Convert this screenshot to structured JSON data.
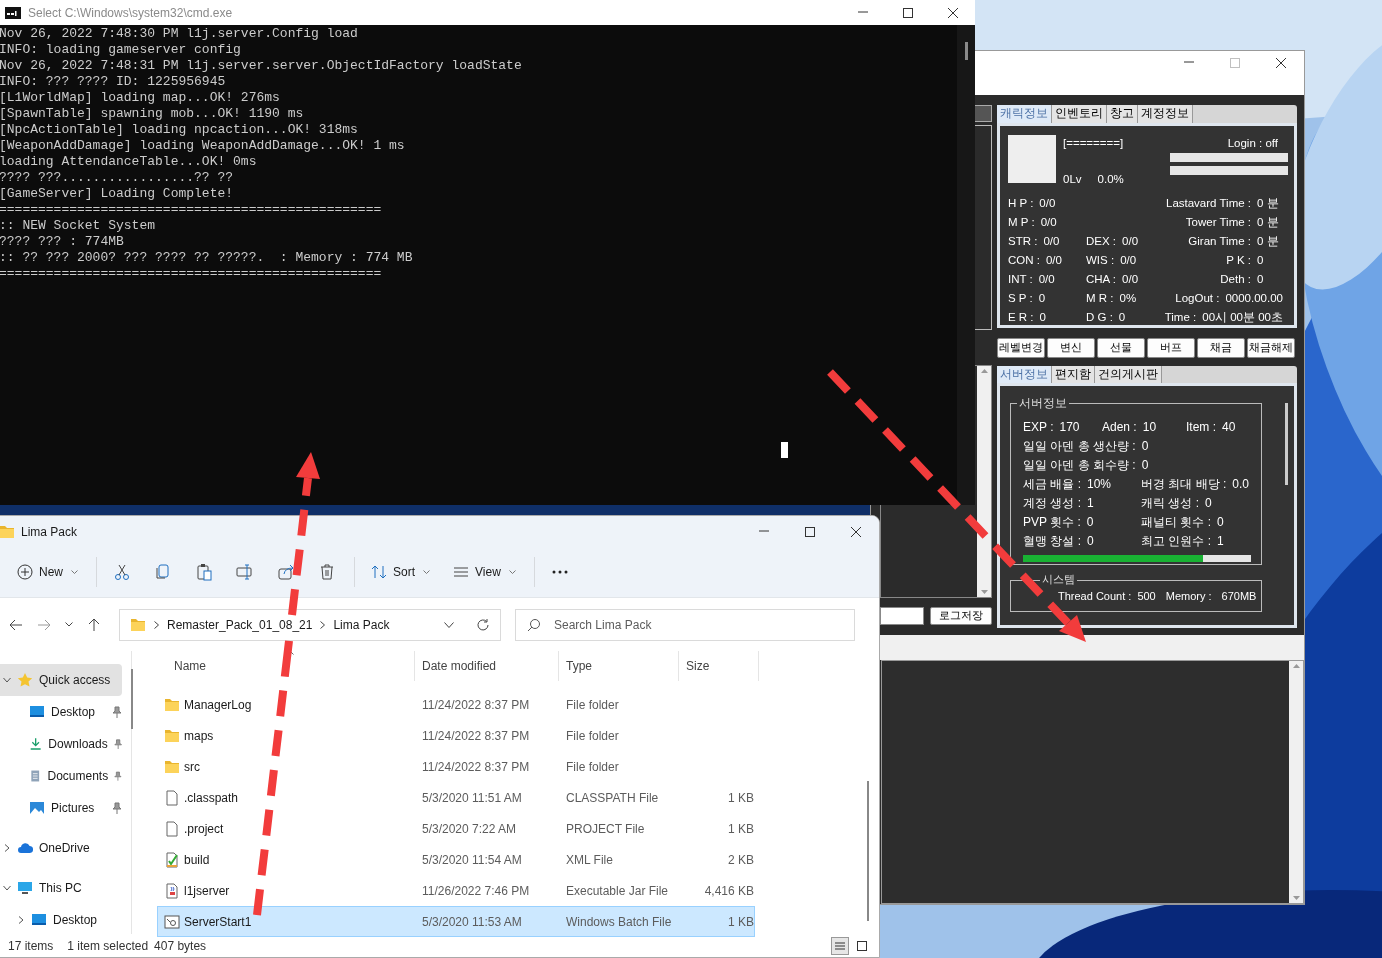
{
  "cmd_window": {
    "title": "Select C:\\Windows\\system32\\cmd.exe",
    "lines": [
      "Nov 26, 2022 7:48:30 PM l1j.server.Config load",
      "INFO: loading gameserver config",
      "Nov 26, 2022 7:48:31 PM l1j.server.server.ObjectIdFactory loadState",
      "INFO: ??? ???? ID: 1225956945",
      "[L1WorldMap] loading map...OK! 276ms",
      "[SpawnTable] spawning mob...OK! 1190 ms",
      "[NpcActionTable] loading npcaction...OK! 318ms",
      "[WeaponAddDamage] loading WeaponAddDamage...OK! 1 ms",
      "loading AttendanceTable...OK! 0ms",
      "???? ???.................?? ??",
      "[GameServer] Loading Complete!",
      "=================================================",
      ":: NEW Socket System",
      "???? ??? : 774MB",
      ":: ?? ??? 2000? ??? ???? ?? ?????.  : Memory : 774 MB",
      "================================================="
    ]
  },
  "manager_window": {
    "char_tabs": [
      {
        "label": "캐릭정보",
        "selected": true
      },
      {
        "label": "인벤토리",
        "selected": false
      },
      {
        "label": "창고",
        "selected": false
      },
      {
        "label": "계정정보",
        "selected": false
      }
    ],
    "exp_bar": "[========]",
    "level": "0Lv",
    "exp_percent": "0.0%",
    "login": "Login : off",
    "meters": [
      {
        "level": 0
      },
      {
        "level": 0
      }
    ],
    "stats_left": [
      {
        "label": "H P :",
        "value": "0/0"
      },
      {
        "label": "M P :",
        "value": "0/0"
      },
      {
        "label": "STR :",
        "value": "0/0"
      },
      {
        "label": "CON :",
        "value": "0/0"
      },
      {
        "label": "INT :",
        "value": "0/0"
      },
      {
        "label": "S P :",
        "value": "0"
      },
      {
        "label": "E R :",
        "value": "0"
      }
    ],
    "stats_middle": [
      {
        "label": "DEX :",
        "value": "0/0"
      },
      {
        "label": "WIS :",
        "value": "0/0"
      },
      {
        "label": "CHA :",
        "value": "0/0"
      },
      {
        "label": "M R :",
        "value": "0%"
      },
      {
        "label": "D G :",
        "value": "0"
      }
    ],
    "stats_right": [
      {
        "label": "Lastavard Time :",
        "value": "0 분"
      },
      {
        "label": "Tower Time :",
        "value": "0 분"
      },
      {
        "label": "Giran Time :",
        "value": "0 분"
      },
      {
        "label": "P K :",
        "value": "0"
      },
      {
        "label": "Deth :",
        "value": "0"
      },
      {
        "label": "LogOut :",
        "value": "0000.00.00"
      },
      {
        "label": "Time :",
        "value": "00시 00분 00초"
      }
    ],
    "action_buttons": [
      "레벨변경",
      "변신",
      "선물",
      "버프",
      "채금",
      "채금해제"
    ],
    "server_tabs": [
      {
        "label": "서버정보",
        "selected": true
      },
      {
        "label": "편지함",
        "selected": false
      },
      {
        "label": "건의게시판",
        "selected": false
      }
    ],
    "server_group": {
      "title": "서버정보",
      "rows": [
        [
          {
            "label": "EXP :",
            "value": "170"
          },
          {
            "label": "Aden :",
            "value": "10"
          },
          {
            "label": "Item :",
            "value": "40"
          }
        ],
        [
          {
            "label": "일일 아덴 총 생산량 :",
            "value": "0"
          }
        ],
        [
          {
            "label": "일일 아덴 총 회수량 :",
            "value": "0"
          }
        ],
        [
          {
            "label": "세금 배율 :",
            "value": "10%"
          },
          {
            "label": "버경 최대 배당 :",
            "value": "0.0"
          }
        ],
        [
          {
            "label": "계정 생성 :",
            "value": "1"
          },
          {
            "label": "캐릭 생성 :",
            "value": "0"
          }
        ],
        [
          {
            "label": "PVP 횟수 :",
            "value": "0"
          },
          {
            "label": "패널티 횟수 :",
            "value": "0"
          }
        ],
        [
          {
            "label": "혈맹 창설 :",
            "value": "0"
          },
          {
            "label": "최고 인원수 :",
            "value": "1"
          }
        ]
      ],
      "load": {
        "level": 0.79
      }
    },
    "system_group": {
      "title": "시스템",
      "items": [
        {
          "label": "Thread Count :",
          "value": "500"
        },
        {
          "label": "Memory :",
          "value": "670MB"
        }
      ]
    },
    "log_save_button": "로그저장"
  },
  "explorer_window": {
    "title": "Lima Pack",
    "new_button": "New",
    "sort_button": "Sort",
    "view_button": "View",
    "breadcrumb": [
      "Remaster_Pack_01_08_21",
      "Lima Pack"
    ],
    "search": {
      "placeholder": "Search Lima Pack"
    },
    "sidebar": [
      {
        "label": "Quick access",
        "kind": "star",
        "expanded": true,
        "selected": true,
        "children": [
          {
            "label": "Desktop",
            "kind": "desktop",
            "pinned": true,
            "selected": false
          },
          {
            "label": "Downloads",
            "kind": "download",
            "pinned": true,
            "selected": false
          },
          {
            "label": "Documents",
            "kind": "documents",
            "pinned": true,
            "selected": false
          },
          {
            "label": "Pictures",
            "kind": "pictures",
            "pinned": true,
            "selected": false
          }
        ]
      },
      {
        "label": "OneDrive",
        "kind": "cloud",
        "expanded": false,
        "selected": false
      },
      {
        "label": "This PC",
        "kind": "pc",
        "expanded": true,
        "selected": false,
        "children": [
          {
            "label": "Desktop",
            "kind": "desktop",
            "expanded": false,
            "selected": false
          }
        ]
      }
    ],
    "columns": [
      {
        "label": "Name",
        "sorted": true
      },
      {
        "label": "Date modified",
        "sorted": false
      },
      {
        "label": "Type",
        "sorted": false
      },
      {
        "label": "Size",
        "sorted": false
      }
    ],
    "rows": [
      {
        "name": "ManagerLog",
        "date": "11/24/2022 8:37 PM",
        "type": "File folder",
        "kind": "folder",
        "selected": false
      },
      {
        "name": "maps",
        "date": "11/24/2022 8:37 PM",
        "type": "File folder",
        "kind": "folder",
        "selected": false
      },
      {
        "name": "src",
        "date": "11/24/2022 8:37 PM",
        "type": "File folder",
        "kind": "folder",
        "selected": false
      },
      {
        "name": ".classpath",
        "date": "5/3/2020 11:51 AM",
        "type": "CLASSPATH File",
        "size": "1 KB",
        "kind": "file",
        "selected": false
      },
      {
        "name": ".project",
        "date": "5/3/2020 7:22 AM",
        "type": "PROJECT File",
        "size": "1 KB",
        "kind": "file",
        "selected": false
      },
      {
        "name": "build",
        "date": "5/3/2020 11:54 AM",
        "type": "XML File",
        "size": "2 KB",
        "kind": "xml",
        "selected": false
      },
      {
        "name": "l1jserver",
        "date": "11/26/2022 7:46 PM",
        "type": "Executable Jar File",
        "size": "4,416 KB",
        "kind": "jar",
        "selected": false
      },
      {
        "name": "ServerStart1",
        "date": "5/3/2020 11:53 AM",
        "type": "Windows Batch File",
        "size": "1 KB",
        "kind": "bat",
        "selected": true
      }
    ],
    "status_bar": {
      "item_count": "17 items",
      "selection": "1 item selected",
      "selection_size": "407 bytes"
    },
    "view_buttons": [
      {
        "kind": "details",
        "selected": true
      },
      {
        "kind": "tiles",
        "selected": false
      }
    ]
  }
}
